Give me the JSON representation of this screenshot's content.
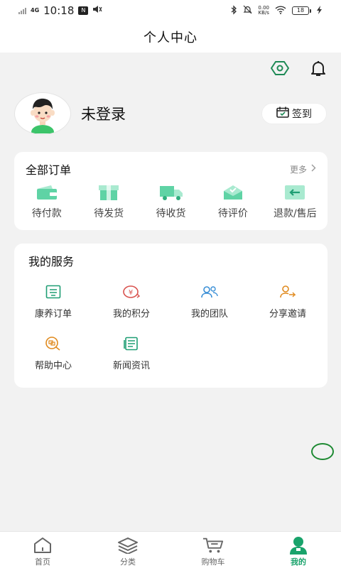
{
  "status_bar": {
    "network": "4G",
    "time": "10:18",
    "chip_label": "N",
    "speed_top": "0.00",
    "speed_bottom": "KB/s",
    "battery": "18"
  },
  "header": {
    "title": "个人中心"
  },
  "profile": {
    "username": "未登录",
    "signin_label": "签到"
  },
  "orders": {
    "title": "全部订单",
    "more_label": "更多",
    "items": [
      {
        "label": "待付款",
        "icon": "wallet-icon"
      },
      {
        "label": "待发货",
        "icon": "box-icon"
      },
      {
        "label": "待收货",
        "icon": "truck-icon"
      },
      {
        "label": "待评价",
        "icon": "review-icon"
      },
      {
        "label": "退款/售后",
        "icon": "refund-icon"
      }
    ]
  },
  "services": {
    "title": "我的服务",
    "items": [
      {
        "label": "康养订单",
        "icon": "order-list-icon",
        "color": "#1f9e74"
      },
      {
        "label": "我的积分",
        "icon": "points-icon",
        "color": "#d9534f"
      },
      {
        "label": "我的团队",
        "icon": "team-icon",
        "color": "#3a8fd6"
      },
      {
        "label": "分享邀请",
        "icon": "share-icon",
        "color": "#e08a1e"
      },
      {
        "label": "帮助中心",
        "icon": "help-icon",
        "color": "#e08a1e"
      },
      {
        "label": "新闻资讯",
        "icon": "news-icon",
        "color": "#1f9e74"
      }
    ]
  },
  "tabbar": {
    "items": [
      {
        "label": "首页",
        "icon": "home-icon",
        "active": false
      },
      {
        "label": "分类",
        "icon": "category-icon",
        "active": false
      },
      {
        "label": "购物车",
        "icon": "cart-icon",
        "active": false
      },
      {
        "label": "我的",
        "icon": "user-icon",
        "active": true
      }
    ]
  },
  "colors": {
    "accent": "#19a36b",
    "order_icon": "#5fd3a5",
    "background": "#f2f2f2"
  }
}
